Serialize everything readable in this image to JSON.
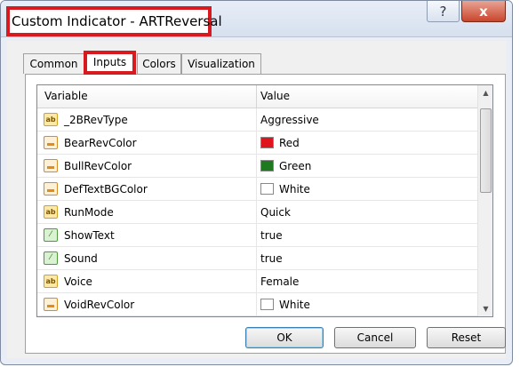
{
  "window": {
    "title": "Custom Indicator - ARTReversal",
    "help_label": "?",
    "close_label": "x"
  },
  "tabs": [
    {
      "label": "Common"
    },
    {
      "label": "Inputs",
      "active": true
    },
    {
      "label": "Colors"
    },
    {
      "label": "Visualization"
    }
  ],
  "grid": {
    "headers": {
      "variable": "Variable",
      "value": "Value"
    },
    "rows": [
      {
        "icon": "ab-string-icon",
        "variable": "_2BRevType",
        "value": "Aggressive"
      },
      {
        "icon": "color-icon",
        "variable": "BearRevColor",
        "value": "Red",
        "swatch": "#e0141c"
      },
      {
        "icon": "color-icon",
        "variable": "BullRevColor",
        "value": "Green",
        "swatch": "#1f7a1f"
      },
      {
        "icon": "color-icon",
        "variable": "DefTextBGColor",
        "value": "White",
        "swatch": "#ffffff"
      },
      {
        "icon": "ab-string-icon",
        "variable": "RunMode",
        "value": "Quick"
      },
      {
        "icon": "bool-icon",
        "variable": "ShowText",
        "value": "true"
      },
      {
        "icon": "bool-icon",
        "variable": "Sound",
        "value": "true"
      },
      {
        "icon": "ab-string-icon",
        "variable": "Voice",
        "value": "Female"
      },
      {
        "icon": "color-icon",
        "variable": "VoidRevColor",
        "value": "White",
        "swatch": "#ffffff"
      }
    ]
  },
  "buttons": {
    "ok": "OK",
    "cancel": "Cancel",
    "reset": "Reset"
  },
  "icon_glyphs": {
    "ab": "ab",
    "bool": "⁄"
  },
  "colors": {
    "highlight": "#d71920"
  }
}
